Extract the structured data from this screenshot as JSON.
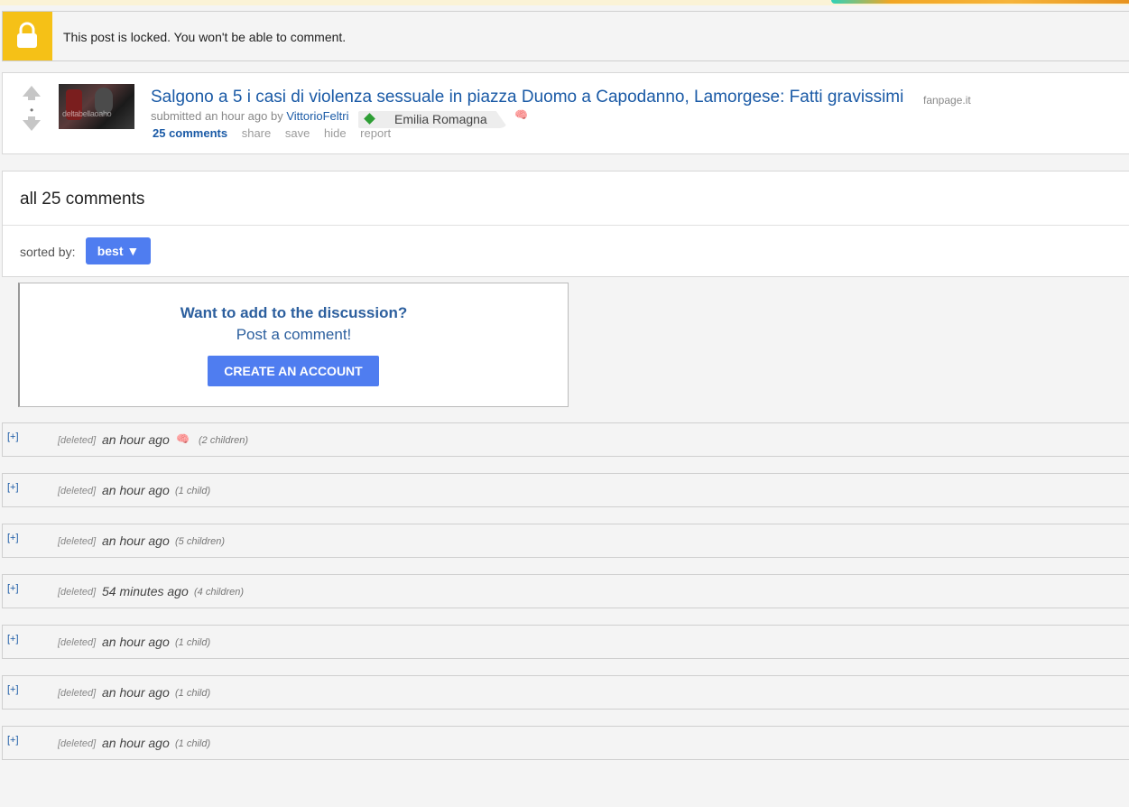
{
  "locked": {
    "message": "This post is locked. You won't be able to comment."
  },
  "post": {
    "score": "•",
    "thumbnail_text": "deltabellaoaho",
    "title": "Salgono a 5 i casi di violenza sessuale in piazza Duomo a Capodanno, Lamorgese: Fatti gravissimi",
    "domain": "fanpage.it",
    "submitted_prefix": "submitted an hour ago by",
    "author": "VittorioFeltri",
    "flair": "Emilia Romagna",
    "brain_icon": "🧠",
    "buttons": {
      "comments": "25 comments",
      "share": "share",
      "save": "save",
      "hide": "hide",
      "report": "report"
    }
  },
  "comments_header": {
    "title": "all 25 comments",
    "sorted_label": "sorted by:",
    "sort_value": "best ▼"
  },
  "cta": {
    "question": "Want to add to the discussion?",
    "prompt": "Post a comment!",
    "button": "CREATE AN ACCOUNT"
  },
  "comments": [
    {
      "expand": "[+]",
      "author": "[deleted]",
      "time": "an hour ago",
      "children": "(2 children)",
      "brain": "🧠"
    },
    {
      "expand": "[+]",
      "author": "[deleted]",
      "time": "an hour ago",
      "children": "(1 child)"
    },
    {
      "expand": "[+]",
      "author": "[deleted]",
      "time": "an hour ago",
      "children": "(5 children)"
    },
    {
      "expand": "[+]",
      "author": "[deleted]",
      "time": "54 minutes ago",
      "children": "(4 children)"
    },
    {
      "expand": "[+]",
      "author": "[deleted]",
      "time": "an hour ago",
      "children": "(1 child)"
    },
    {
      "expand": "[+]",
      "author": "[deleted]",
      "time": "an hour ago",
      "children": "(1 child)"
    },
    {
      "expand": "[+]",
      "author": "[deleted]",
      "time": "an hour ago",
      "children": "(1 child)"
    }
  ]
}
